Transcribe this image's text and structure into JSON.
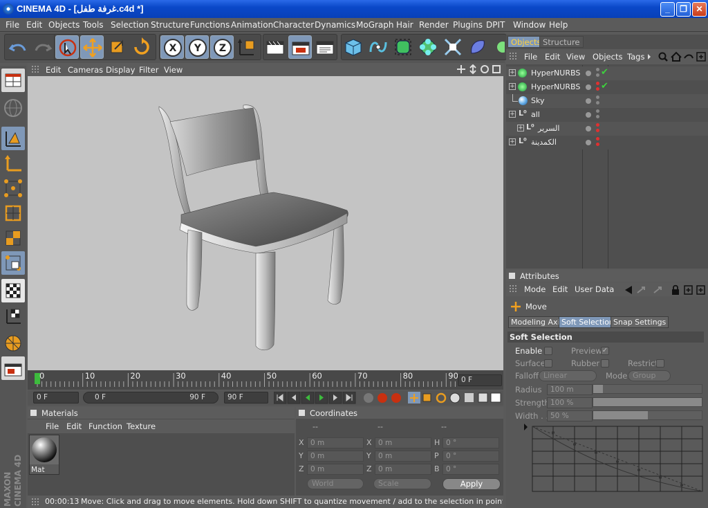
{
  "window": {
    "title": "CINEMA 4D - [غرفة طفل.c4d *]"
  },
  "menu": [
    "File",
    "Edit",
    "Objects",
    "Tools",
    "Selection",
    "Structure",
    "Functions",
    "Animation",
    "Character",
    "Dynamics",
    "MoGraph",
    "Hair",
    "Render",
    "Plugins",
    "DPIT",
    "Window",
    "Help"
  ],
  "viewport": {
    "menu": [
      "Edit",
      "Cameras",
      "Display",
      "Filter",
      "View"
    ]
  },
  "timeline": {
    "ticks": [
      "0",
      "10",
      "20",
      "30",
      "40",
      "50",
      "60",
      "70",
      "80",
      "90"
    ],
    "current_frame": "0 F"
  },
  "time_controls": {
    "start": "0 F",
    "range_start": "0 F",
    "range_end": "90 F",
    "end": "90 F"
  },
  "materials": {
    "title": "Materials",
    "menu": [
      "File",
      "Edit",
      "Function",
      "Texture"
    ],
    "items": [
      {
        "name": "Mat"
      }
    ]
  },
  "coordinates": {
    "title": "Coordinates",
    "headers": [
      "--",
      "--",
      "--"
    ],
    "rows": [
      {
        "a_label": "X",
        "a_val": "0 m",
        "b_label": "X",
        "b_val": "0 m",
        "c_label": "H",
        "c_val": "0 °"
      },
      {
        "a_label": "Y",
        "a_val": "0 m",
        "b_label": "Y",
        "b_val": "0 m",
        "c_label": "P",
        "c_val": "0 °"
      },
      {
        "a_label": "Z",
        "a_val": "0 m",
        "b_label": "Z",
        "b_val": "0 m",
        "c_label": "B",
        "c_val": "0 °"
      }
    ],
    "space": "World",
    "mode": "Scale",
    "apply": "Apply"
  },
  "status": {
    "time": "00:00:13",
    "message": "Move: Click and drag to move elements. Hold down SHIFT to quantize movement / add to the selection in point mode, CTRL to re"
  },
  "objects": {
    "tabs": [
      "Objects",
      "Structure"
    ],
    "menu": [
      "File",
      "Edit",
      "View",
      "Objects",
      "Tags"
    ],
    "items": [
      {
        "name": "HyperNURBS"
      },
      {
        "name": "HyperNURBS"
      },
      {
        "name": "Sky"
      },
      {
        "name": "all"
      },
      {
        "name": "السرير"
      },
      {
        "name": "الكمدينة"
      }
    ]
  },
  "attributes": {
    "title": "Attributes",
    "menu": [
      "Mode",
      "Edit",
      "User Data"
    ],
    "tool": "Move",
    "tabs": [
      "Modeling Axis",
      "Soft Selection",
      "Snap Settings"
    ],
    "section": "Soft Selection",
    "enable": "Enable",
    "preview": "Preview",
    "surface": "Surface",
    "rubber": "Rubber",
    "restrict": "Restrict",
    "falloff_label": "Falloff",
    "falloff": "Linear",
    "mode_label": "Mode",
    "mode": "Group",
    "radius_label": "Radius",
    "radius": "100 m",
    "strength_label": "Strength",
    "strength": "100 %",
    "width_label": "Width . .",
    "width": "50 %",
    "strength_fraction": 1.0,
    "width_fraction": 0.5
  }
}
